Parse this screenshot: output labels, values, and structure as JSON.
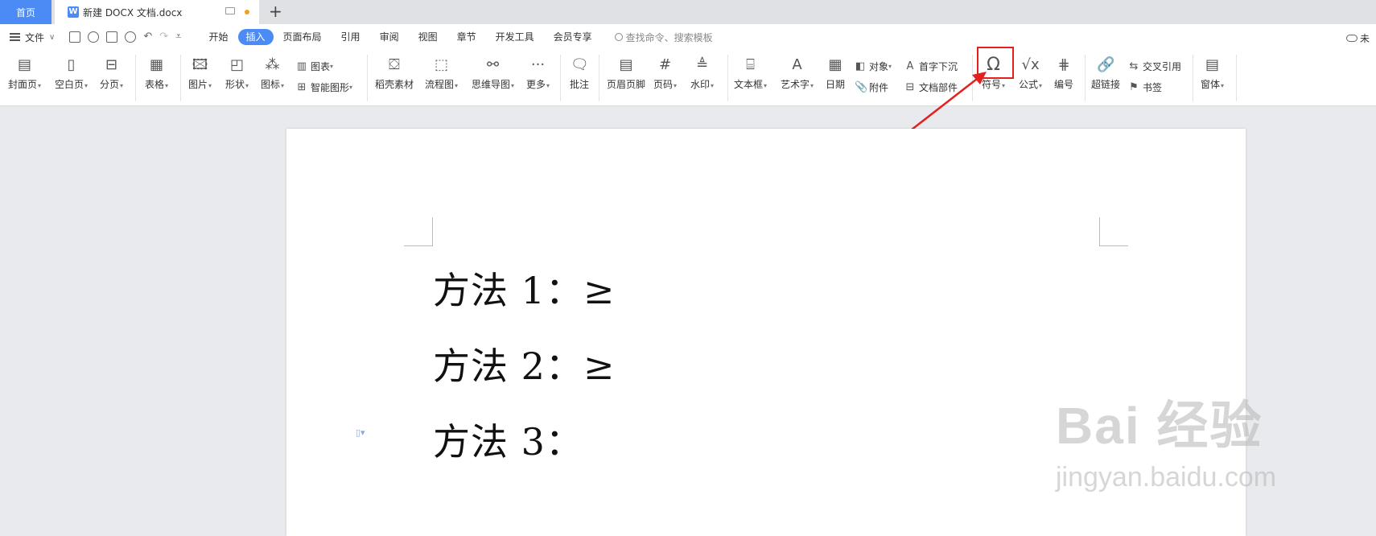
{
  "tabs": {
    "home": "首页",
    "doc_title": "新建 DOCX 文档.docx",
    "doc_icon": "W",
    "new_tab": "+"
  },
  "menubar": {
    "file": "文件",
    "items": [
      "开始",
      "插入",
      "页面布局",
      "引用",
      "审阅",
      "视图",
      "章节",
      "开发工具",
      "会员专享"
    ],
    "active": "插入",
    "search_placeholder": "查找命令、搜索模板",
    "cloud": "未"
  },
  "ribbon": {
    "cover": "封面页",
    "blank": "空白页",
    "pagebreak": "分页",
    "table": "表格",
    "picture": "图片",
    "shape": "形状",
    "icon": "图标",
    "chart": "图表",
    "smartart": "智能图形",
    "material": "稻壳素材",
    "flow": "流程图",
    "mindmap": "思维导图",
    "more": "更多",
    "comment": "批注",
    "headerfooter": "页眉页脚",
    "pagenum": "页码",
    "watermark": "水印",
    "textbox": "文本框",
    "wordart": "艺术字",
    "date": "日期",
    "object": "对象",
    "attach": "附件",
    "dropcap": "首字下沉",
    "docpart": "文档部件",
    "symbol": "符号",
    "formula": "公式",
    "numbering": "编号",
    "hyperlink": "超链接",
    "crossref": "交叉引用",
    "bookmark": "书签",
    "window": "窗体"
  },
  "document": {
    "lines": [
      "方法 1：≥",
      "方法 2：≥",
      "方法 3："
    ]
  },
  "watermark": {
    "brand": "Bai 经验",
    "url": "jingyan.baidu.com"
  },
  "colors": {
    "accent": "#4a8bf5",
    "highlight": "#e32020"
  }
}
